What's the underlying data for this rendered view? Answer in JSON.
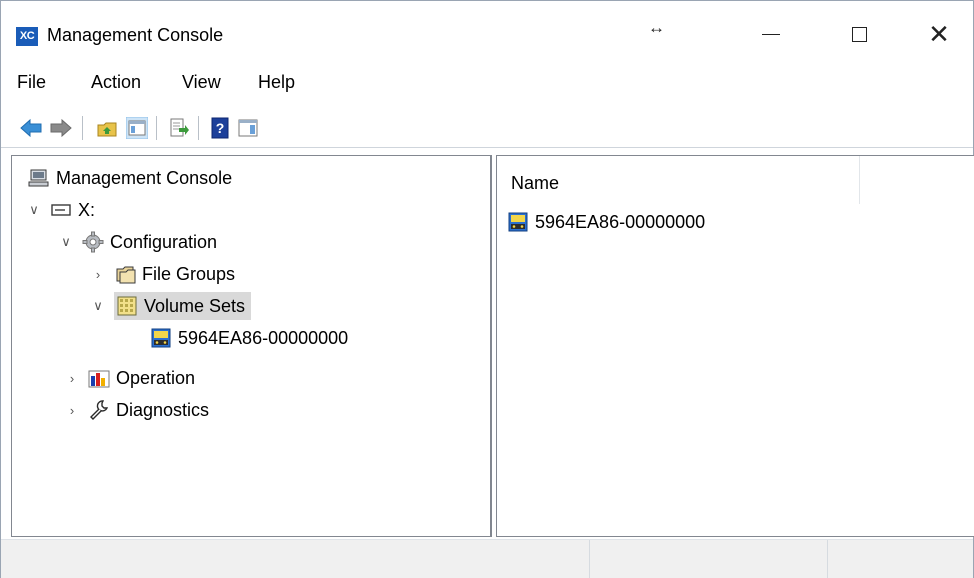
{
  "window": {
    "title": "Management Console",
    "app_icon_label": "XC",
    "resize_indicator": "↔",
    "minimize_icon": "minimize-icon",
    "maximize_icon": "maximize-icon",
    "close_icon": "close-icon",
    "close_glyph": "✕"
  },
  "menubar": {
    "items": [
      "File",
      "Action",
      "View",
      "Help"
    ]
  },
  "toolbar": {
    "buttons": [
      {
        "name": "back-button",
        "icon": "back-arrow-icon"
      },
      {
        "name": "forward-button",
        "icon": "forward-arrow-icon"
      },
      {
        "name": "up-level-button",
        "icon": "folder-up-icon"
      },
      {
        "name": "show-hide-tree-button",
        "icon": "console-tree-icon"
      },
      {
        "name": "export-list-button",
        "icon": "export-list-icon"
      },
      {
        "name": "help-button",
        "icon": "help-icon"
      },
      {
        "name": "show-hide-action-pane-button",
        "icon": "action-pane-icon"
      }
    ]
  },
  "tree": {
    "root": "Management Console",
    "drive": "X:",
    "configuration": "Configuration",
    "file_groups": "File Groups",
    "volume_sets": "Volume Sets",
    "volume_item": "5964EA86-00000000",
    "operation": "Operation",
    "diagnostics": "Diagnostics",
    "expanded_glyph": "∨",
    "collapsed_glyph": "›"
  },
  "list": {
    "column_name": "Name",
    "items": [
      "5964EA86-00000000"
    ]
  },
  "colors": {
    "accent": "#1a5cb8",
    "selection": "#d9d9d9",
    "border": "#828790"
  }
}
